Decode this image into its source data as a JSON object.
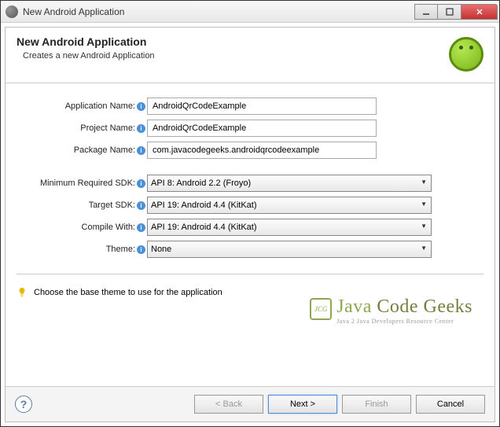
{
  "window": {
    "title": "New Android Application"
  },
  "header": {
    "title": "New Android Application",
    "description": "Creates a new Android Application"
  },
  "form": {
    "app_name": {
      "label": "Application Name:",
      "value": "AndroidQrCodeExample"
    },
    "project_name": {
      "label": "Project Name:",
      "value": "AndroidQrCodeExample"
    },
    "package_name": {
      "label": "Package Name:",
      "value": "com.javacodegeeks.androidqrcodeexample"
    },
    "min_sdk": {
      "label": "Minimum Required SDK:",
      "value": "API 8: Android 2.2 (Froyo)"
    },
    "target_sdk": {
      "label": "Target SDK:",
      "value": "API 19: Android 4.4 (KitKat)"
    },
    "compile_with": {
      "label": "Compile With:",
      "value": "API 19: Android 4.4 (KitKat)"
    },
    "theme": {
      "label": "Theme:",
      "value": "None"
    }
  },
  "hint": {
    "text": "Choose the base theme to use for the application"
  },
  "watermark": {
    "main1": "Java ",
    "main2": "Code Geeks",
    "sub": "Java 2 Java Developers Resource Center",
    "badge": "JCG"
  },
  "buttons": {
    "back": "< Back",
    "next": "Next >",
    "finish": "Finish",
    "cancel": "Cancel"
  }
}
